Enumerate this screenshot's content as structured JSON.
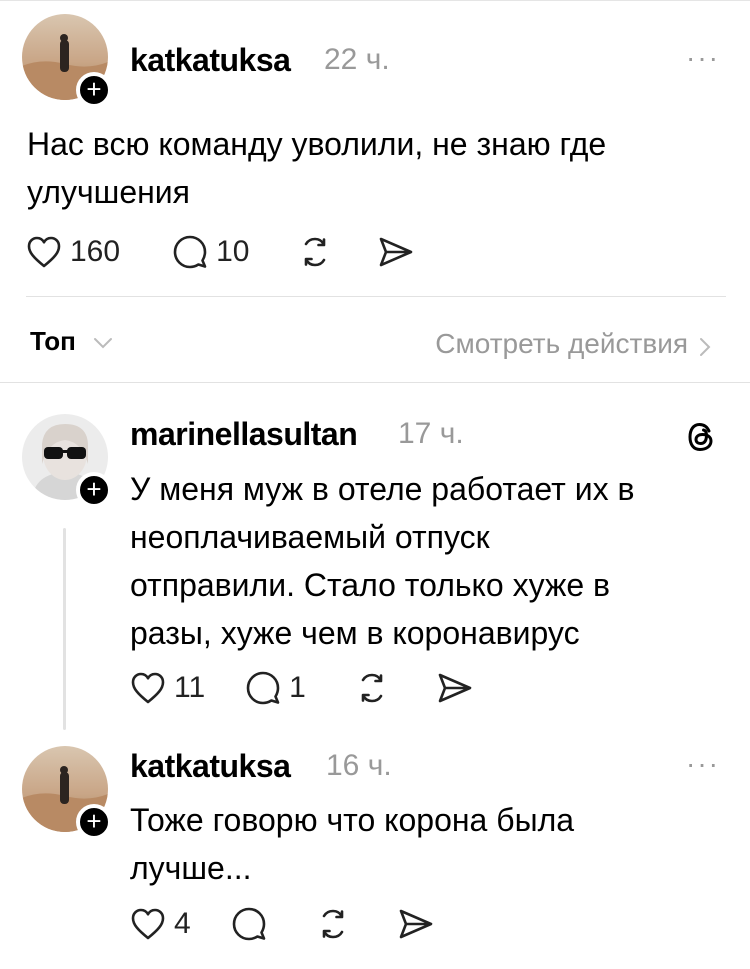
{
  "post": {
    "username": "katkatuksa",
    "time": "22 ч.",
    "text_line1": "Нас всю команду уволили, не знаю где",
    "text_line2": "улучшения",
    "likes": "160",
    "comments": "10"
  },
  "sort_bar": {
    "sort_label": "Топ",
    "view_activity": "Смотреть действия"
  },
  "replies": [
    {
      "username": "marinellasultan",
      "time": "17 ч.",
      "lines": [
        "У меня муж в отеле работает их в",
        "неоплачиваемый отпуск",
        "отправили. Стало только хуже в",
        "разы, хуже чем в коронавирус"
      ],
      "likes": "11",
      "comments": "1"
    },
    {
      "username": "katkatuksa",
      "time": "16 ч.",
      "lines": [
        "Тоже говорю что корона была",
        "лучше..."
      ],
      "likes": "4",
      "comments": ""
    }
  ],
  "icons": {
    "like": "heart-icon",
    "comment": "comment-bubble-icon",
    "repost": "repost-icon",
    "share": "send-icon",
    "more": "more-dots-icon",
    "follow": "plus-icon",
    "threads_logo": "threads-icon"
  },
  "colors": {
    "text": "#000000",
    "muted": "#999999",
    "divider": "#e2e2e2",
    "background": "#ffffff"
  }
}
